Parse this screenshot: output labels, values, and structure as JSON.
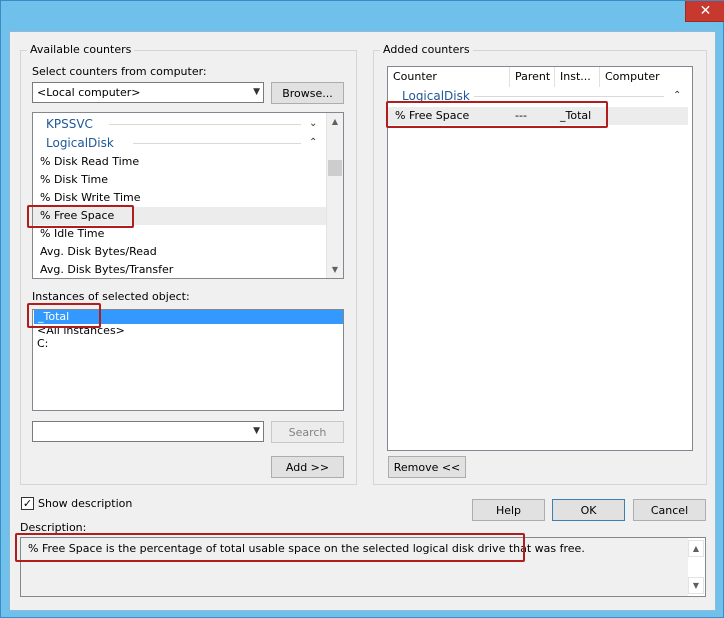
{
  "window": {
    "close_glyph": "✕"
  },
  "available": {
    "group_title": "Available counters",
    "select_label": "Select counters from computer:",
    "computer_value": "<Local computer>",
    "browse_label": "Browse...",
    "counters": [
      {
        "type": "category",
        "label": "KPSSVC",
        "expanded": false
      },
      {
        "type": "category",
        "label": "LogicalDisk",
        "expanded": true
      },
      {
        "type": "item",
        "label": "% Disk Read Time"
      },
      {
        "type": "item",
        "label": "% Disk Time"
      },
      {
        "type": "item",
        "label": "% Disk Write Time"
      },
      {
        "type": "item",
        "label": "% Free Space",
        "selected": true
      },
      {
        "type": "item",
        "label": "% Idle Time"
      },
      {
        "type": "item",
        "label": "Avg. Disk Bytes/Read"
      },
      {
        "type": "item",
        "label": "Avg. Disk Bytes/Transfer"
      }
    ],
    "instances_label": "Instances of selected object:",
    "instances": [
      {
        "label": "_Total",
        "selected": true
      },
      {
        "label": "<All instances>"
      },
      {
        "label": "C:"
      }
    ],
    "search_value": "",
    "search_label": "Search",
    "add_label": "Add >>"
  },
  "added": {
    "group_title": "Added counters",
    "columns": [
      "Counter",
      "Parent",
      "Inst...",
      "Computer"
    ],
    "category": "LogicalDisk",
    "rows": [
      {
        "counter": "% Free Space",
        "parent": "---",
        "instance": "_Total",
        "computer": ""
      }
    ],
    "remove_label": "Remove <<"
  },
  "show_description": {
    "label": "Show description",
    "checked": true
  },
  "buttons": {
    "help": "Help",
    "ok": "OK",
    "cancel": "Cancel"
  },
  "description": {
    "label": "Description:",
    "text": "% Free Space is the percentage of total usable space on the selected logical disk drive that was free."
  },
  "colors": {
    "title_bar": "#6fc0ea",
    "close": "#c7382f",
    "highlight": "#b11c1c",
    "selection": "#3399ff",
    "category_text": "#1e5799"
  }
}
